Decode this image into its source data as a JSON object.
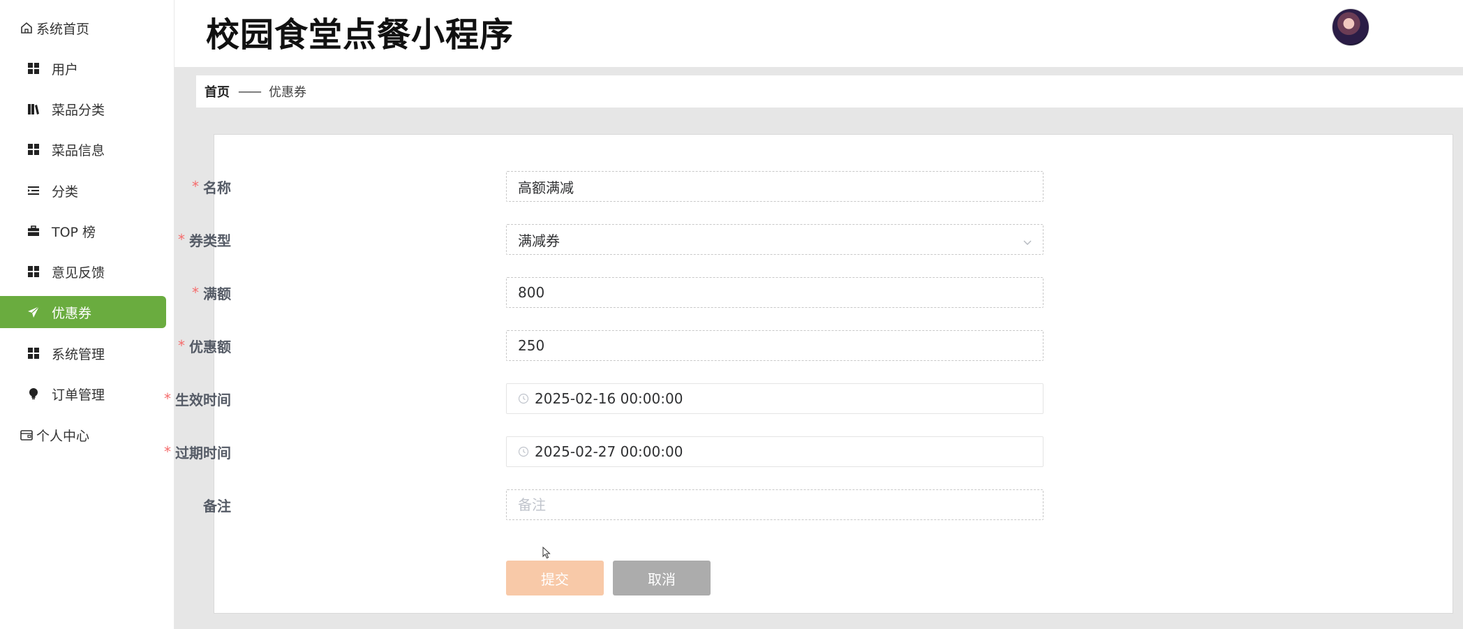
{
  "app": {
    "title": "校园食堂点餐小程序"
  },
  "sidebar": {
    "items": [
      {
        "label": "系统首页",
        "icon": "home-icon"
      },
      {
        "label": "用户",
        "icon": "grid-icon"
      },
      {
        "label": "菜品分类",
        "icon": "books-icon"
      },
      {
        "label": "菜品信息",
        "icon": "grid-icon"
      },
      {
        "label": "分类",
        "icon": "list-indent-icon"
      },
      {
        "label": "TOP 榜",
        "icon": "briefcase-icon"
      },
      {
        "label": "意见反馈",
        "icon": "grid-icon"
      },
      {
        "label": "优惠券",
        "icon": "paper-plane-icon",
        "active": true
      },
      {
        "label": "系统管理",
        "icon": "grid-icon"
      },
      {
        "label": "订单管理",
        "icon": "lightbulb-icon"
      },
      {
        "label": "个人中心",
        "icon": "wallet-icon"
      }
    ]
  },
  "breadcrumb": {
    "home": "首页",
    "separator": "——",
    "current": "优惠券"
  },
  "form": {
    "required_mark": "*",
    "name": {
      "label": "名称",
      "value": "高额满减"
    },
    "coupon_type": {
      "label": "券类型",
      "value": "满减券"
    },
    "threshold": {
      "label": "满额",
      "value": "800"
    },
    "discount": {
      "label": "优惠额",
      "value": "250"
    },
    "start_time": {
      "label": "生效时间",
      "value": "2025-02-16 00:00:00"
    },
    "end_time": {
      "label": "过期时间",
      "value": "2025-02-27 00:00:00"
    },
    "remark": {
      "label": "备注",
      "value": "",
      "placeholder": "备注"
    },
    "submit_label": "提交",
    "cancel_label": "取消"
  },
  "colors": {
    "active_nav": "#6aac3f",
    "required": "#f56c6c",
    "submit_button": "#f8c9a8",
    "cancel_button": "#acacac"
  }
}
